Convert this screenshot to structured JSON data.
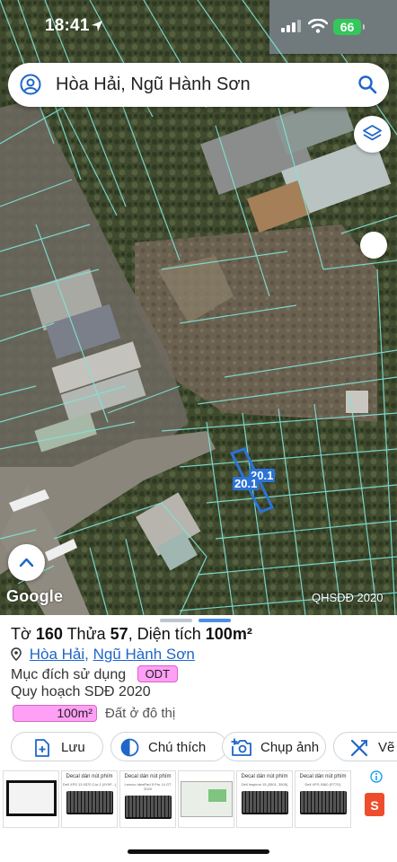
{
  "status_bar": {
    "time": "18:41",
    "battery": "66"
  },
  "search": {
    "query": "Hòa Hải, Ngũ Hành Sơn"
  },
  "map": {
    "attribution": "Google",
    "source": "QHSDĐ 2020",
    "parcel_labels": [
      "20.1",
      "20.1"
    ]
  },
  "parcel": {
    "sheet_label": "Tờ",
    "sheet_no": "160",
    "plot_label": "Thửa",
    "plot_no": "57",
    "area_label": "Diện tích",
    "area": "100m²",
    "ward": "Hòa Hải",
    "district": "Ngũ Hành Sơn",
    "purpose_label": "Mục đích sử dụng",
    "purpose_code": "ODT",
    "plan_label": "Quy hoạch SDĐ 2020",
    "plan_area": "100m²",
    "plan_type": "Đất ở đô thị"
  },
  "actions": {
    "save": "Lưu",
    "legend": "Chú thích",
    "capture": "Chụp ảnh",
    "draw": "Vẽ"
  },
  "ads": [
    {
      "title": "",
      "sub": ""
    },
    {
      "title": "Decal dán nút phím",
      "sub": "Dell XPS 13 9370 2-in-1 (9Y9F...)"
    },
    {
      "title": "Decal dán nút phím",
      "sub": "Lenovo IdeaPad 5 Pro 14 GT 2020"
    },
    {
      "title": "",
      "sub": ""
    },
    {
      "title": "Decal dán nút phím",
      "sub": "Dell Inspiron 15 (3501, 3505)"
    },
    {
      "title": "Decal dán nút phím",
      "sub": "Dell XPS 9360 (P77G)"
    }
  ],
  "colors": {
    "accent": "#1e66c7",
    "odt": "#ff9ff5",
    "parcel_lines": "#7fe3d8",
    "selected_parcel": "#2b73d6"
  }
}
